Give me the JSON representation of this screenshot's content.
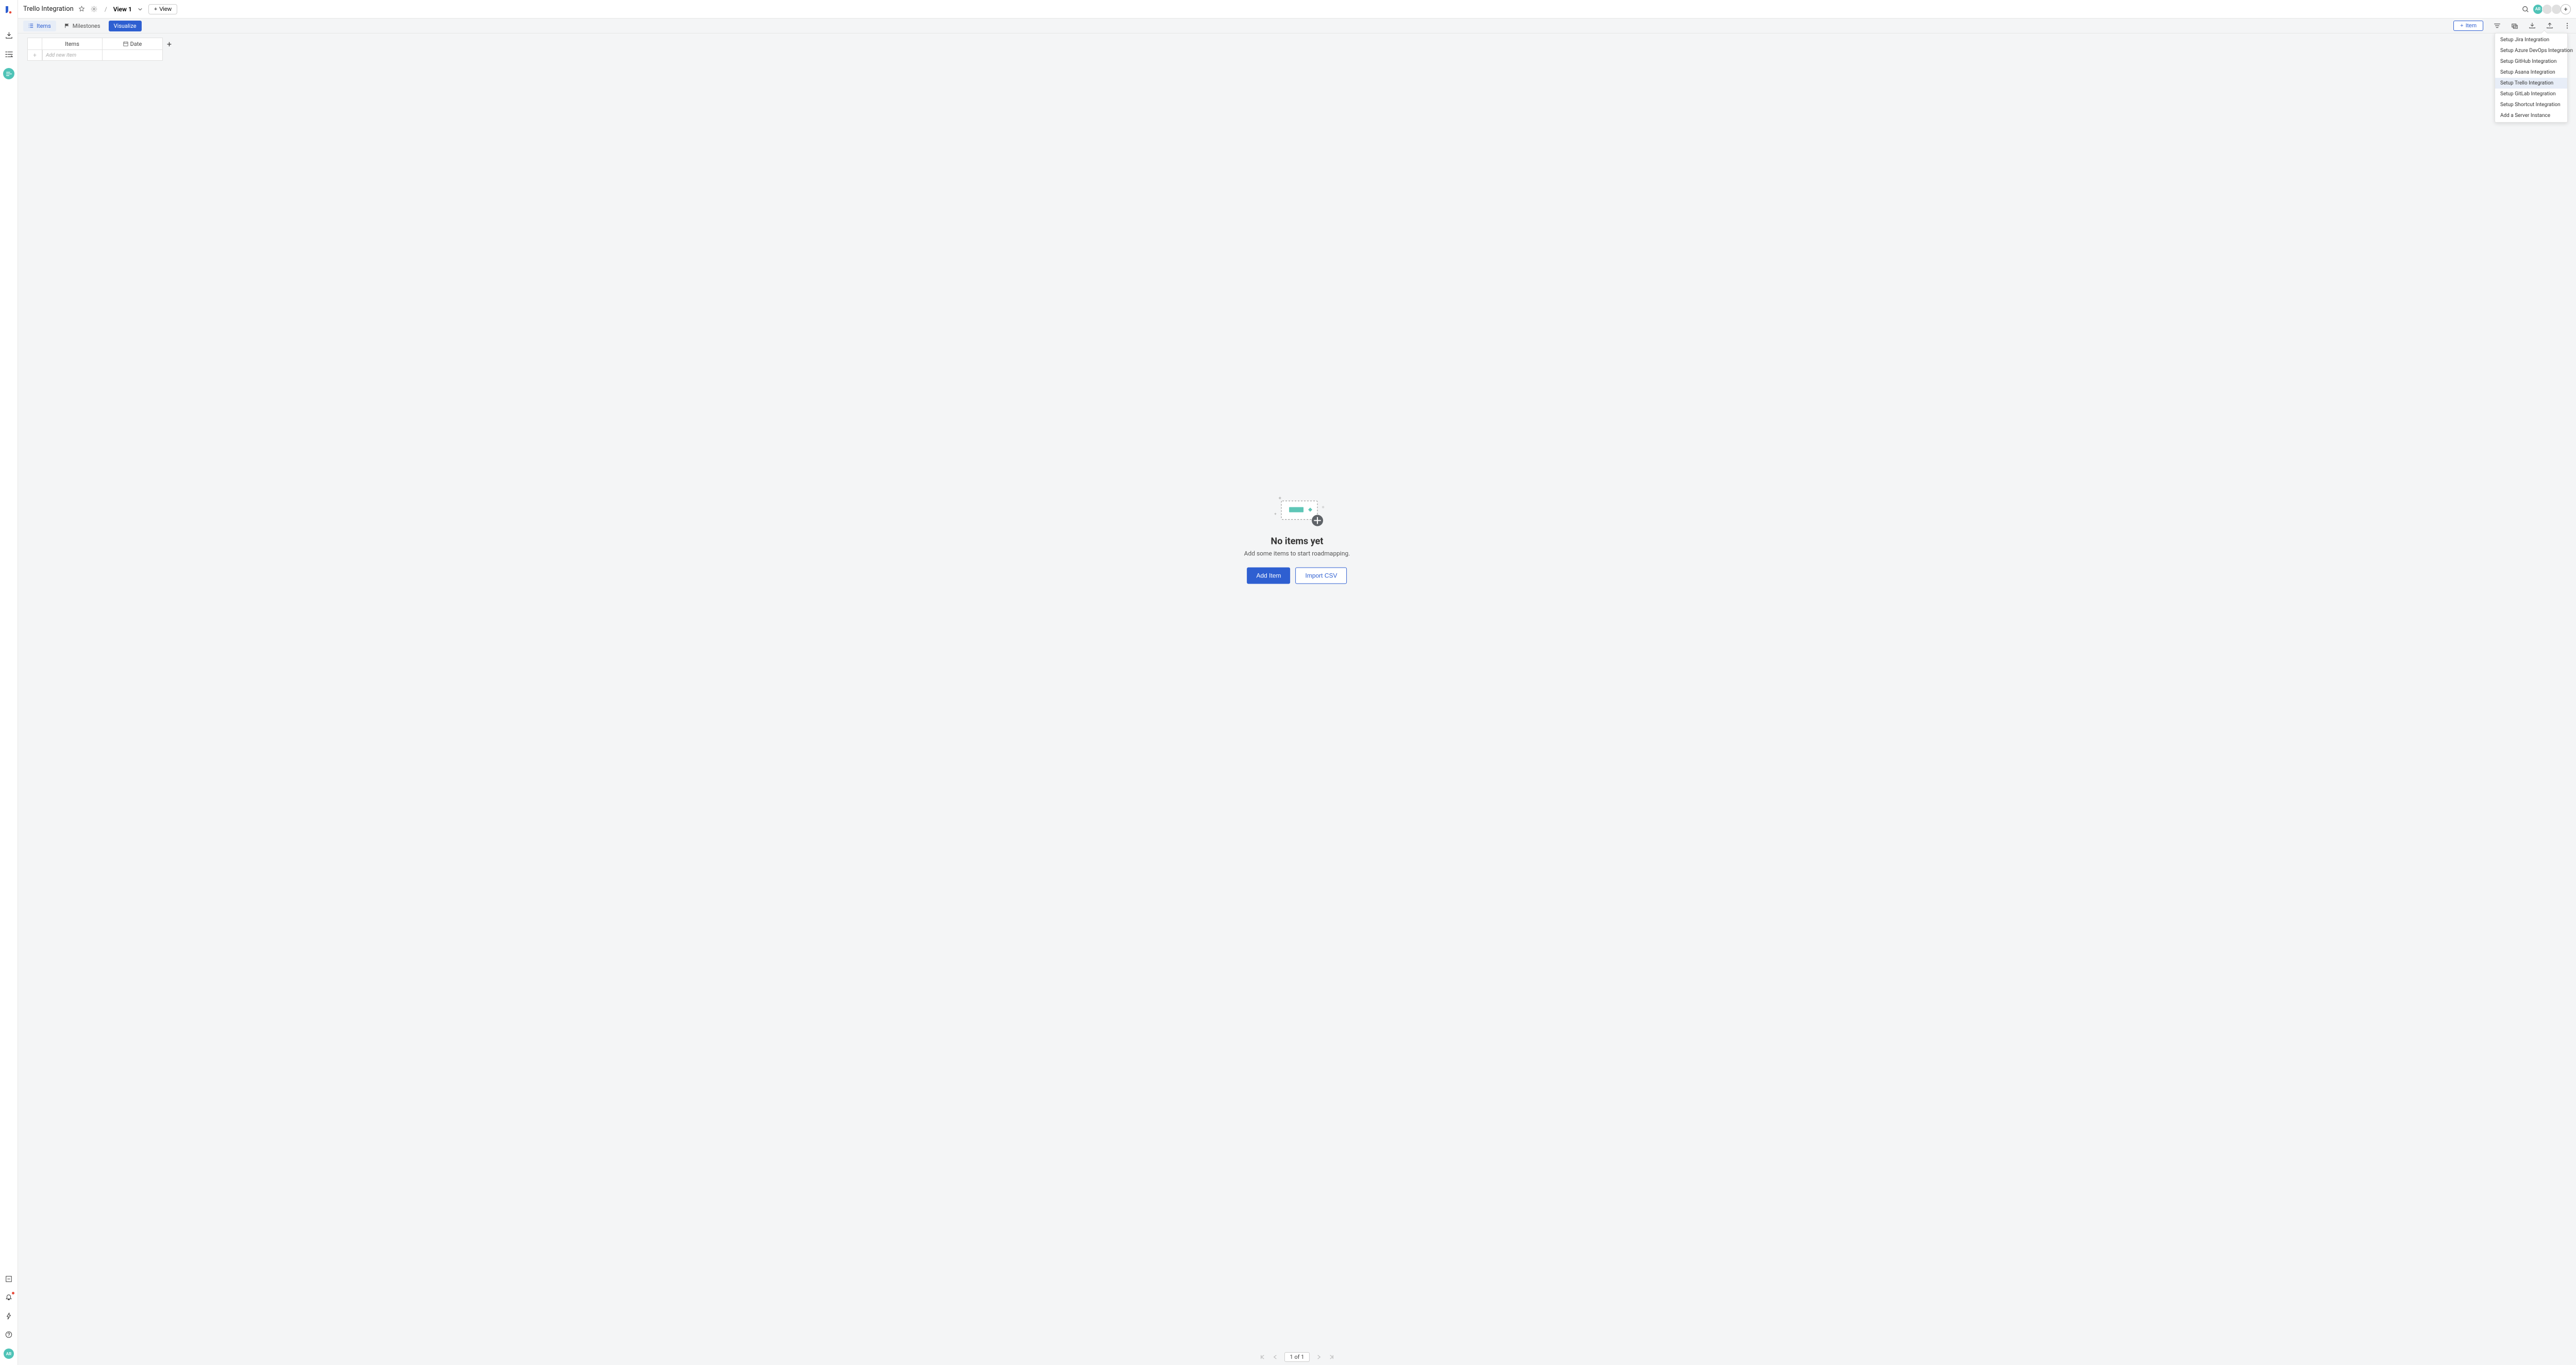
{
  "header": {
    "title": "Trello Integration",
    "view_label": "View 1",
    "add_view_label": "View"
  },
  "avatar_initials": "AR",
  "tabs": {
    "items": "Items",
    "milestones": "Milestones",
    "visualize": "Visualize"
  },
  "toolbar": {
    "add_item": "Item"
  },
  "dropdown": {
    "items": [
      {
        "label": "Setup Jira Integration",
        "highlighted": false
      },
      {
        "label": "Setup Azure DevOps Integration",
        "highlighted": false
      },
      {
        "label": "Setup GitHub Integration",
        "highlighted": false
      },
      {
        "label": "Setup Asana Integration",
        "highlighted": false
      },
      {
        "label": "Setup Trello Integration",
        "highlighted": true
      },
      {
        "label": "Setup GitLab Integration",
        "highlighted": false
      },
      {
        "label": "Setup Shortcut Integration",
        "highlighted": false
      },
      {
        "label": "Add a Server Instance",
        "highlighted": false
      }
    ]
  },
  "grid": {
    "col_items": "Items",
    "col_date": "Date",
    "add_new_placeholder": "Add new item"
  },
  "empty": {
    "title": "No items yet",
    "subtitle": "Add some items to start roadmapping.",
    "primary": "Add Item",
    "secondary": "Import CSV"
  },
  "pager": {
    "label": "1 of 1"
  }
}
